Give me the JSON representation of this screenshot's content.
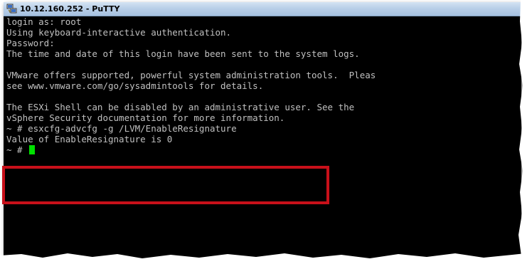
{
  "window": {
    "title": "10.12.160.252 - PuTTY",
    "app_icon": "putty-computer-icon"
  },
  "terminal": {
    "lines": [
      "login as: root",
      "Using keyboard-interactive authentication.",
      "Password:",
      "The time and date of this login have been sent to the system logs.",
      "",
      "VMware offers supported, powerful system administration tools.  Pleas",
      "see www.vmware.com/go/sysadmintools for details.",
      "",
      "The ESXi Shell can be disabled by an administrative user. See the",
      "vSphere Security documentation for more information.",
      "~ # esxcfg-advcfg -g /LVM/EnableResignature",
      "Value of EnableResignature is 0",
      "~ # "
    ],
    "cursor_color": "#00e000",
    "text_color": "#c0c0c0",
    "background_color": "#000000"
  },
  "annotation": {
    "highlight_color": "#c8101a"
  }
}
